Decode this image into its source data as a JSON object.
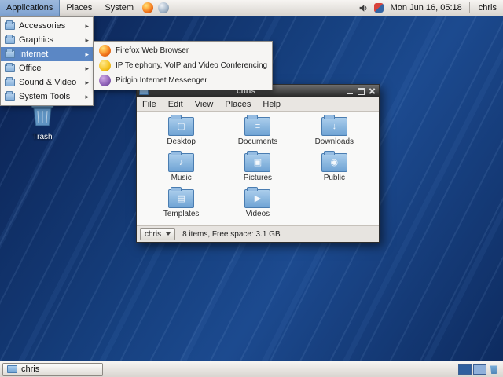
{
  "colors": {
    "selection_blue": "#5b87c5",
    "wallpaper_blue": "#16407f",
    "folder_blue": "#8fb9e0",
    "panel_gray": "#d9d5d0"
  },
  "top_panel": {
    "menus": [
      "Applications",
      "Places",
      "System"
    ],
    "launcher_icons": [
      "firefox-icon",
      "app-launcher-icon"
    ],
    "status_icons": [
      "volume-icon",
      "notification-icon"
    ],
    "clock": "Mon Jun 16, 05:18",
    "user": "chris"
  },
  "applications_menu": {
    "items": [
      {
        "label": "Accessories"
      },
      {
        "label": "Graphics"
      },
      {
        "label": "Internet",
        "highlighted": true
      },
      {
        "label": "Office"
      },
      {
        "label": "Sound & Video"
      },
      {
        "label": "System Tools"
      }
    ]
  },
  "internet_submenu": {
    "items": [
      {
        "label": "Firefox Web Browser",
        "icon": "firefox-icon"
      },
      {
        "label": "IP Telephony, VoIP and Video Conferencing",
        "icon": "voip-phone-icon"
      },
      {
        "label": "Pidgin Internet Messenger",
        "icon": "pidgin-icon"
      }
    ]
  },
  "desktop": {
    "trash_label": "Trash"
  },
  "file_manager": {
    "title": "chris",
    "menu": [
      "File",
      "Edit",
      "View",
      "Places",
      "Help"
    ],
    "folders": [
      {
        "label": "Desktop",
        "icon": "desktop-folder-icon",
        "glyph": "▢"
      },
      {
        "label": "Documents",
        "icon": "documents-folder-icon",
        "glyph": "≡"
      },
      {
        "label": "Downloads",
        "icon": "downloads-folder-icon",
        "glyph": "↓"
      },
      {
        "label": "Music",
        "icon": "music-folder-icon",
        "glyph": "♪"
      },
      {
        "label": "Pictures",
        "icon": "pictures-folder-icon",
        "glyph": "▣"
      },
      {
        "label": "Public",
        "icon": "public-folder-icon",
        "glyph": "◉"
      },
      {
        "label": "Templates",
        "icon": "templates-folder-icon",
        "glyph": "▤"
      },
      {
        "label": "Videos",
        "icon": "videos-folder-icon",
        "glyph": "▶"
      }
    ],
    "location": "chris",
    "status": "8 items, Free space: 3.1 GB"
  },
  "bottom_panel": {
    "window_button": "chris"
  }
}
